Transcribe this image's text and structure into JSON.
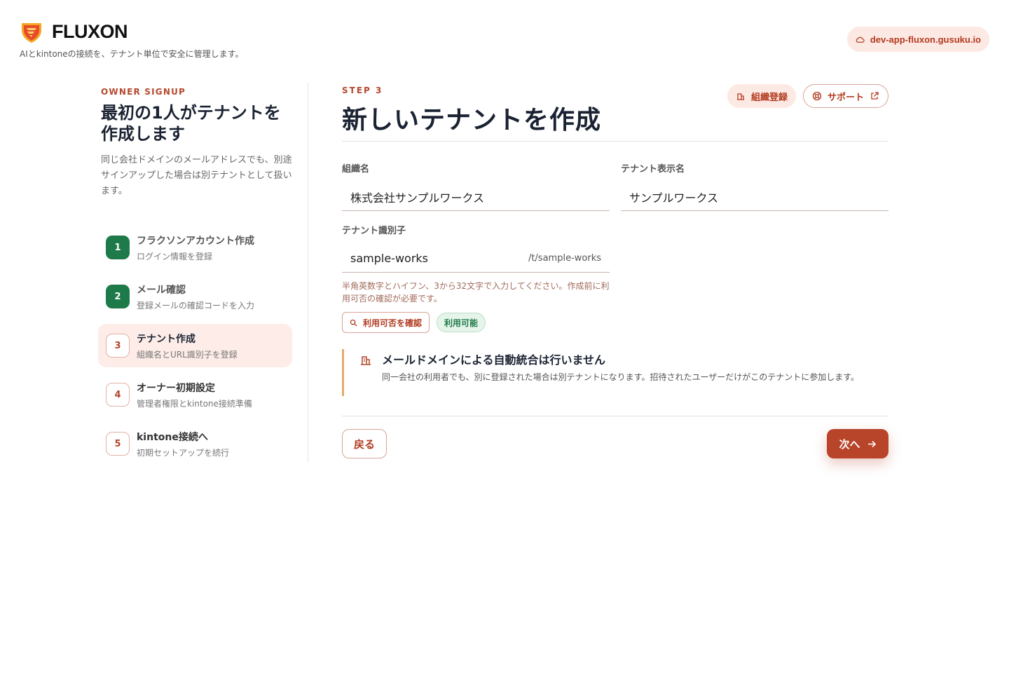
{
  "brand": {
    "name": "FLUXON",
    "tagline": "AIとkintoneの接続を、テナント単位で安全に管理します。"
  },
  "env": {
    "host": "dev-app-fluxon.gusuku.io",
    "icon": "cloud-icon"
  },
  "sidebar": {
    "eyebrow": "OWNER SIGNUP",
    "heading_line1": "最初の1人がテナントを",
    "heading_line2": "作成します",
    "description": "同じ会社ドメインのメールアドレスでも、別途サインアップした場合は別テナントとして扱います。",
    "steps": [
      {
        "num": "1",
        "title": "フラクソンアカウント作成",
        "subtitle": "ログイン情報を登録",
        "state": "done"
      },
      {
        "num": "2",
        "title": "メール確認",
        "subtitle": "登録メールの確認コードを入力",
        "state": "done"
      },
      {
        "num": "3",
        "title": "テナント作成",
        "subtitle": "組織名とURL識別子を登録",
        "state": "active"
      },
      {
        "num": "4",
        "title": "オーナー初期設定",
        "subtitle": "管理者権限とkintone接続準備",
        "state": "todo"
      },
      {
        "num": "5",
        "title": "kintone接続へ",
        "subtitle": "初期セットアップを続行",
        "state": "todo"
      }
    ]
  },
  "main": {
    "step_label": "STEP 3",
    "title": "新しいテナントを作成",
    "actions": {
      "org_register": "組織登録",
      "support": "サポート"
    },
    "fields": {
      "org_name": {
        "label": "組織名",
        "value": "株式会社サンプルワークス"
      },
      "display_name": {
        "label": "テナント表示名",
        "value": "サンプルワークス"
      },
      "tenant_id": {
        "label": "テナント識別子",
        "value": "sample-works",
        "suffix": "/t/sample-works",
        "hint": "半角英数字とハイフン、3から32文字で入力してください。作成前に利用可否の確認が必要です。",
        "check_button": "利用可否を確認",
        "status": "利用可能"
      }
    },
    "notice": {
      "title": "メールドメインによる自動統合は行いません",
      "body": "同一会社の利用者でも、別に登録された場合は別テナントになります。招待されたユーザーだけがこのテナントに参加します。"
    },
    "buttons": {
      "back": "戻る",
      "next": "次へ"
    }
  },
  "colors": {
    "accent": "#b8442a",
    "success": "#1f7a4a",
    "soft": "#fde9e3",
    "warning_border": "#e6a86a"
  }
}
